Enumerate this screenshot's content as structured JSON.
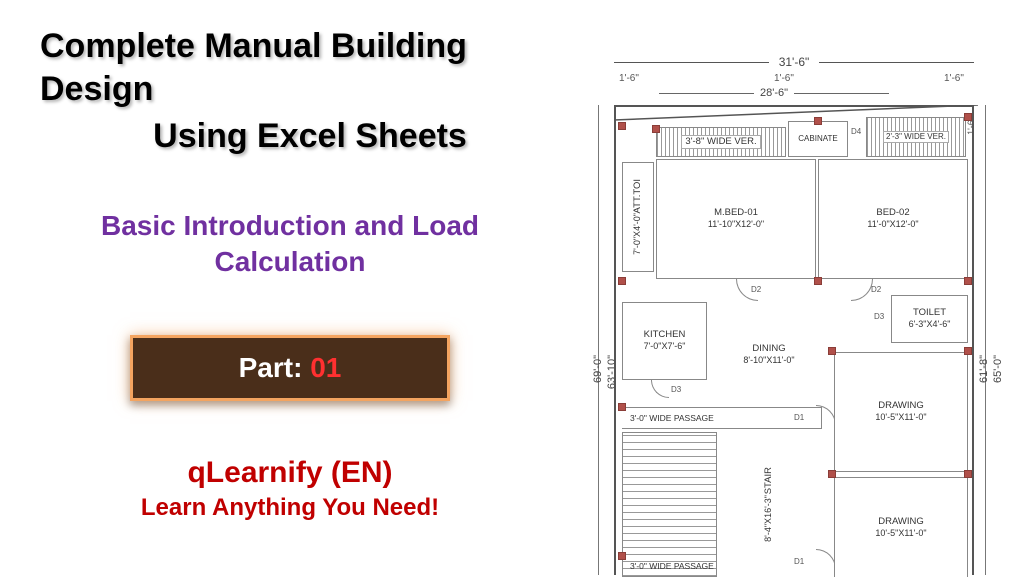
{
  "title": {
    "line1": "Complete Manual Building Design",
    "line2": "Using Excel Sheets"
  },
  "subtitle": "Basic Introduction and Load Calculation",
  "part": {
    "label": "Part: ",
    "number": "01"
  },
  "brand": {
    "name": "qLearnify (EN)",
    "tagline": "Learn Anything You Need!"
  },
  "floorplan": {
    "dims": {
      "overall_width": "31'-6\"",
      "inner_width": "28'-6\"",
      "seg_left": "1'-6\"",
      "seg_mid": "1'-6\"",
      "seg_right": "1'-6\"",
      "left_outer": "69'-0\"",
      "left_inner": "63'-10\"",
      "right_outer": "65'-0\"",
      "right_inner": "61'-8\"",
      "right_top_small": "1'-6\""
    },
    "rooms": {
      "ver1": {
        "name": "3'-8\" WIDE VER."
      },
      "cabinate": {
        "name": "CABINATE"
      },
      "ver2": {
        "name": "2'-3\" WIDE VER."
      },
      "att_toi": {
        "name": "ATT.TOI",
        "dim": "7'-0\"X4'-0\""
      },
      "mbed01": {
        "name": "M.BED-01",
        "dim": "11'-10\"X12'-0\""
      },
      "bed02": {
        "name": "BED-02",
        "dim": "11'-0\"X12'-0\""
      },
      "kitchen": {
        "name": "KITCHEN",
        "dim": "7'-0\"X7'-6\""
      },
      "dining": {
        "name": "DINING",
        "dim": "8'-10\"X11'-0\""
      },
      "toilet": {
        "name": "TOILET",
        "dim": "6'-3\"X4'-6\""
      },
      "passage1": {
        "name": "3'-0\" WIDE PASSAGE"
      },
      "passage2": {
        "name": "3'-0\" WIDE PASSAGE"
      },
      "stair": {
        "name": "STAIR",
        "dim": "8'-4\"X16'-3\""
      },
      "drawing1": {
        "name": "DRAWING",
        "dim": "10'-5\"X11'-0\""
      },
      "drawing2": {
        "name": "DRAWING",
        "dim": "10'-5\"X11'-0\""
      }
    },
    "door_labels": {
      "d1": "D1",
      "d2": "D2",
      "d3": "D3",
      "d4": "D4"
    }
  }
}
